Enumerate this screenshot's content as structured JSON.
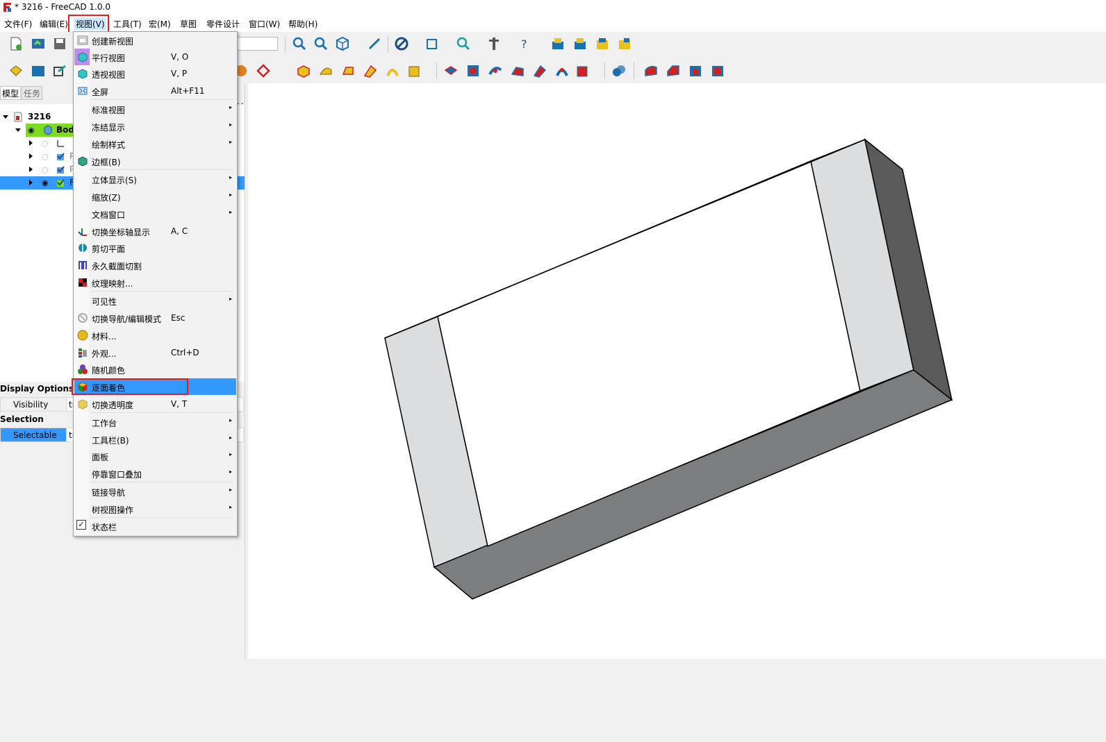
{
  "window": {
    "title": "* 3216 - FreeCAD 1.0.0"
  },
  "menubar": {
    "items": [
      "文件(F)",
      "编辑(E)",
      "视图(V)",
      "工具(T)",
      "宏(M)",
      "草图",
      "零件设计",
      "窗口(W)",
      "帮助(H)"
    ],
    "active": "视图(V)"
  },
  "left_panel": {
    "tabs": [
      "模型",
      "任务"
    ],
    "tree": {
      "root": "3216",
      "body": "Bod",
      "child_selected_label": "F",
      "child_labels": [
        "P",
        "P"
      ]
    },
    "properties": {
      "groups": [
        {
          "name": "Display Options",
          "rows": [
            {
              "name": "Visibility",
              "value": "tr"
            }
          ]
        },
        {
          "name": "Selection",
          "rows": [
            {
              "name": "Selectable",
              "value": "tr"
            }
          ]
        }
      ]
    },
    "close_glyph": "×"
  },
  "view_menu": {
    "items": [
      {
        "label": "创建新视图",
        "shortcut": "",
        "icon": "new-view-icon",
        "submenu": false
      },
      {
        "label": "平行视图",
        "shortcut": "V, O",
        "icon": "orthographic-cube-icon",
        "submenu": false
      },
      {
        "label": "透视视图",
        "shortcut": "V, P",
        "icon": "perspective-cube-icon",
        "submenu": false
      },
      {
        "label": "全屏",
        "shortcut": "Alt+F11",
        "icon": "fullscreen-icon",
        "submenu": false
      },
      {
        "label": "标准视图",
        "shortcut": "",
        "icon": "",
        "submenu": true
      },
      {
        "label": "冻结显示",
        "shortcut": "",
        "icon": "",
        "submenu": true
      },
      {
        "label": "绘制样式",
        "shortcut": "",
        "icon": "",
        "submenu": true
      },
      {
        "label": "边框(B)",
        "shortcut": "",
        "icon": "bounding-box-icon",
        "submenu": false
      },
      {
        "label": "立体显示(S)",
        "shortcut": "",
        "icon": "",
        "submenu": true
      },
      {
        "label": "缩放(Z)",
        "shortcut": "",
        "icon": "",
        "submenu": true
      },
      {
        "label": "文档窗口",
        "shortcut": "",
        "icon": "",
        "submenu": true
      },
      {
        "label": "切换坐标轴显示",
        "shortcut": "A, C",
        "icon": "axis-cross-icon",
        "submenu": false
      },
      {
        "label": "剪切平面",
        "shortcut": "",
        "icon": "clipping-plane-icon",
        "submenu": false
      },
      {
        "label": "永久截面切割",
        "shortcut": "",
        "icon": "section-cut-icon",
        "submenu": false
      },
      {
        "label": "纹理映射...",
        "shortcut": "",
        "icon": "texture-mapping-icon",
        "submenu": false
      },
      {
        "label": "可见性",
        "shortcut": "",
        "icon": "",
        "submenu": true
      },
      {
        "label": "切换导航/编辑模式",
        "shortcut": "Esc",
        "icon": "toggle-navigation-icon",
        "submenu": false
      },
      {
        "label": "材料...",
        "shortcut": "",
        "icon": "material-icon",
        "submenu": false
      },
      {
        "label": "外观...",
        "shortcut": "Ctrl+D",
        "icon": "appearance-icon",
        "submenu": false
      },
      {
        "label": "随机颜色",
        "shortcut": "",
        "icon": "random-color-icon",
        "submenu": false
      },
      {
        "label": "逐面着色",
        "shortcut": "",
        "icon": "color-per-face-icon",
        "submenu": false
      },
      {
        "label": "切换透明度",
        "shortcut": "V, T",
        "icon": "toggle-transparency-icon",
        "submenu": false
      },
      {
        "label": "工作台",
        "shortcut": "",
        "icon": "",
        "submenu": true
      },
      {
        "label": "工具栏(B)",
        "shortcut": "",
        "icon": "",
        "submenu": true
      },
      {
        "label": "面板",
        "shortcut": "",
        "icon": "",
        "submenu": true
      },
      {
        "label": "停靠窗口叠加",
        "shortcut": "",
        "icon": "",
        "submenu": true
      },
      {
        "label": "链接导航",
        "shortcut": "",
        "icon": "",
        "submenu": true
      },
      {
        "label": "树视图操作",
        "shortcut": "",
        "icon": "",
        "submenu": true
      },
      {
        "label": "状态栏",
        "shortcut": "",
        "icon": "checkbox-checked-icon",
        "submenu": false
      }
    ],
    "highlighted": "逐面着色",
    "submenu_glyph": "▸",
    "check_glyph": "✓"
  },
  "colors": {
    "highlight": "#3399ff",
    "annotation_red": "#e02020",
    "tree_green": "#7ddc1f",
    "face_light": "#dcdcdc",
    "face_dark": "#5a5a5a",
    "face_bottom": "#7c7d80"
  }
}
